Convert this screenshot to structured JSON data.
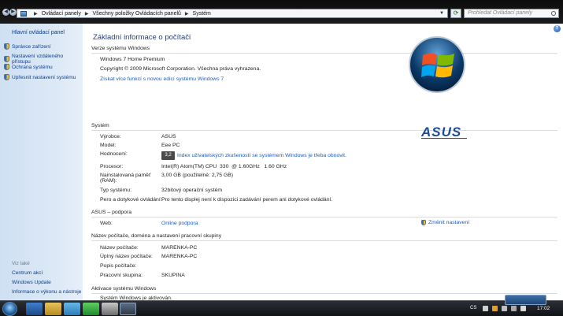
{
  "address": {
    "crumbs": [
      "Ovládací panely",
      "Všechny položky Ovládacích panelů",
      "Systém"
    ],
    "search_placeholder": "Prohledat Ovládací panely"
  },
  "sidebar": {
    "home": "Hlavní ovládací panel",
    "tasks": [
      {
        "label": "Správce zařízení"
      },
      {
        "label": "Nastavení vzdáleného přístupu"
      },
      {
        "label": "Ochrana systému"
      },
      {
        "label": "Upřesnit nastavení systému"
      }
    ],
    "see_also_title": "Viz také",
    "see_also": [
      {
        "label": "Centrum akcí"
      },
      {
        "label": "Windows Update"
      },
      {
        "label": "Informace o výkonu a nástroje"
      }
    ]
  },
  "main": {
    "title": "Základní informace o počítači",
    "edition": {
      "header": "Verze systému Windows",
      "name": "Windows 7 Home Premium",
      "copyright": "Copyright © 2009 Microsoft Corporation. Všechna práva vyhrazena.",
      "more_link": "Získat více funkcí s novou edicí systému Windows 7"
    },
    "system": {
      "header": "Systém",
      "manufacturer_label": "Výrobce:",
      "manufacturer": "ASUS",
      "model_label": "Model:",
      "model": "Eee PC",
      "rating_label": "Hodnocení:",
      "rating_value": "3,2",
      "rating_link": "Index uživatelských zkušeností se systémem Windows je třeba obnovit.",
      "processor_label": "Procesor:",
      "processor": "Intel(R) Atom(TM) CPU  330  @ 1.60GHz   1.60 GHz",
      "ram_label": "Nainstalovaná paměť (RAM):",
      "ram": "3,00 GB (použitelné: 2,75 GB)",
      "type_label": "Typ systému:",
      "type": "32bitový operační systém",
      "pen_label": "Pero a dotykové ovládání:",
      "pen": "Pro tento displej není k dispozici zadávání perem ani dotykové ovládání."
    },
    "support": {
      "header": "ASUS – podpora",
      "web_label": "Web:",
      "web": "Online podpora"
    },
    "computer": {
      "header": "Název počítače, doména a nastavení pracovní skupiny",
      "name_label": "Název počítače:",
      "name": "MARENKA-PC",
      "full_label": "Úplný název počítače:",
      "full": "MARENKA-PC",
      "desc_label": "Popis počítače:",
      "desc": "",
      "wg_label": "Pracovní skupina:",
      "wg": "SKUPINA",
      "change": "Změnit nastavení"
    },
    "activation": {
      "header": "Aktivace systému Windows",
      "status": "Systém Windows je aktivován."
    }
  },
  "taskbar": {
    "lang": "CS",
    "time": "17:02"
  }
}
